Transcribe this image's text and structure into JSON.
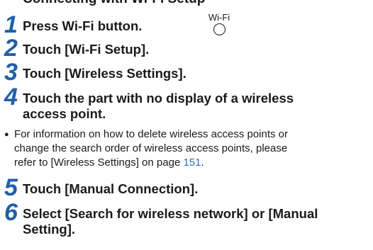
{
  "clipped_heading": "Connecting with Wi-Fi Setup",
  "steps": [
    {
      "number": "1",
      "lines": [
        "Press Wi-Fi button."
      ],
      "button_label": "Wi-Fi"
    },
    {
      "number": "2",
      "lines": [
        "Touch [Wi-Fi Setup]."
      ]
    },
    {
      "number": "3",
      "lines": [
        "Touch [Wireless Settings]."
      ]
    },
    {
      "number": "4",
      "lines": [
        "Touch the part with no display of a wireless",
        "access point."
      ]
    },
    {
      "number": "5",
      "lines": [
        "Touch [Manual Connection]."
      ]
    },
    {
      "number": "6",
      "lines": [
        "Select [Search for wireless network] or [Manual",
        "Setting]."
      ]
    }
  ],
  "note": {
    "bullet": "●",
    "line1": "For information on how to delete wireless access points or",
    "line2": "change the search order of wireless access points, please",
    "line3_prefix": "refer to [Wireless Settings] on page ",
    "line3_link": "151",
    "line3_suffix": "."
  },
  "colors": {
    "step_number": "#1f5fa8",
    "link": "#2b6fc0",
    "text": "#1a1a1a"
  }
}
